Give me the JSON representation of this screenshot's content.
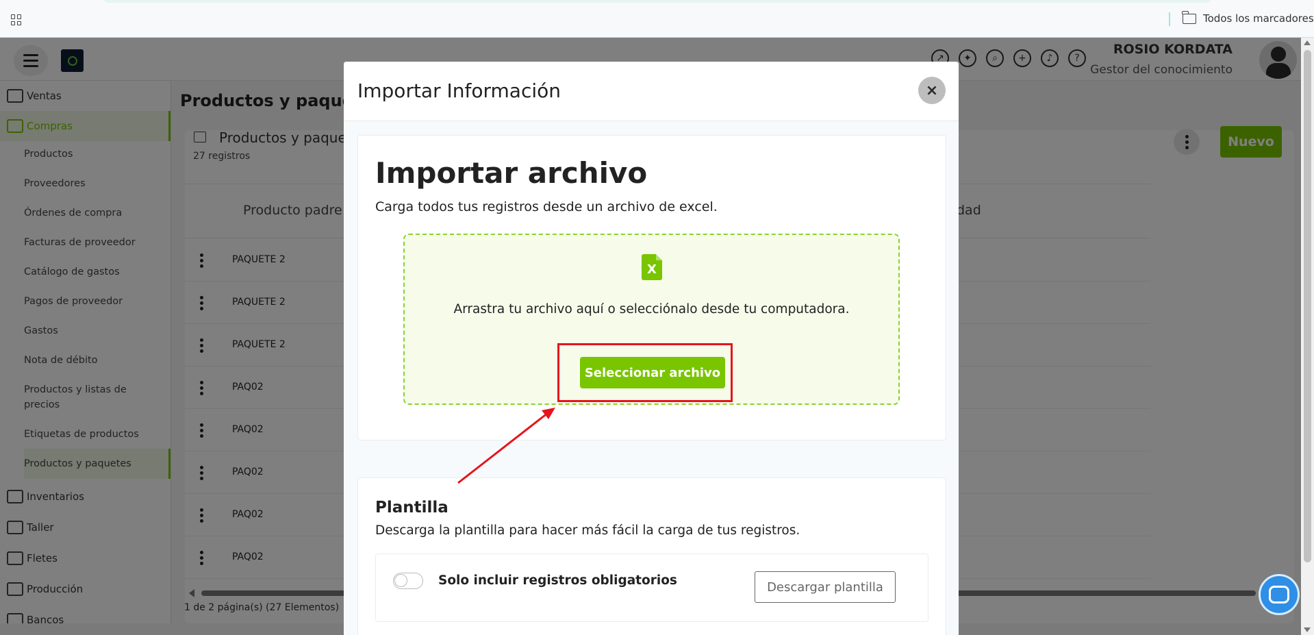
{
  "browser": {
    "bookmarks_label": "Todos los marcadores"
  },
  "header": {
    "user_name": "ROSIO KORDATA",
    "user_role": "Gestor del conocimiento",
    "icons": [
      "external-link-icon",
      "gift-icon",
      "search-zoom-icon",
      "plus-circle-icon",
      "bell-icon",
      "help-icon"
    ]
  },
  "sidebar": {
    "sections": [
      {
        "label": "Ventas",
        "icon": "sales-icon"
      },
      {
        "label": "Compras",
        "icon": "cart-icon"
      },
      {
        "label": "Inventarios",
        "icon": "inventory-icon"
      },
      {
        "label": "Taller",
        "icon": "car-icon"
      },
      {
        "label": "Fletes",
        "icon": "truck-icon"
      },
      {
        "label": "Producción",
        "icon": "factory-icon"
      },
      {
        "label": "Bancos",
        "icon": "bank-icon"
      }
    ],
    "compras_items": [
      "Productos",
      "Proveedores",
      "Órdenes de compra",
      "Facturas de proveedor",
      "Catálogo de gastos",
      "Pagos de proveedor",
      "Gastos",
      "Nota de débito",
      "Productos y listas de precios",
      "Etiquetas de productos",
      "Productos y paquetes"
    ]
  },
  "main": {
    "page_title": "Productos y paquete",
    "card_title": "Productos y paquete",
    "record_count": "27 registros",
    "new_button": "Nuevo",
    "columns": [
      "Producto padre",
      "dad"
    ],
    "rows": [
      "PAQUETE 2",
      "PAQUETE 2",
      "PAQUETE 2",
      "PAQ02",
      "PAQ02",
      "PAQ02",
      "PAQ02",
      "PAQ02"
    ],
    "pager": "1 de 2 página(s) (27 Elementos)"
  },
  "modal": {
    "title": "Importar Información",
    "close_label": "×",
    "import": {
      "title": "Importar archivo",
      "subtitle": "Carga todos tus registros desde un archivo de excel.",
      "file_icon_letter": "X",
      "drop_text": "Arrastra tu archivo aquí o selecciónalo desde tu computadora.",
      "select_button": "Seleccionar archivo"
    },
    "template": {
      "title": "Plantilla",
      "subtitle": "Descarga la plantilla para hacer más fácil la carga de tus registros.",
      "toggle_label": "Solo incluir registros obligatorios",
      "toggle_on": false,
      "download_button": "Descargar plantilla"
    }
  },
  "colors": {
    "accent_green": "#79c500",
    "annotation_red": "#e5141b",
    "chat_blue": "#2f8fe6"
  }
}
